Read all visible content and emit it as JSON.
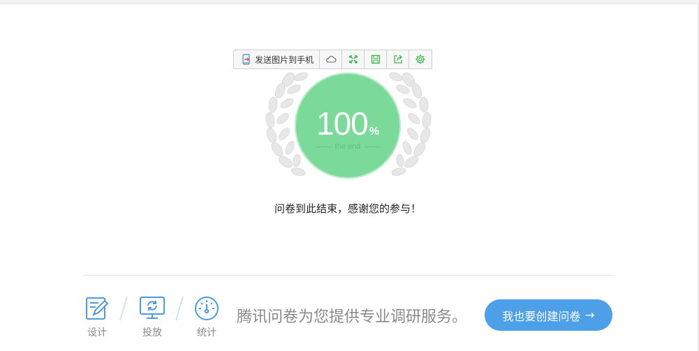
{
  "toolbar": {
    "send_label": "发送图片到手机",
    "buttons": [
      "cloud-icon",
      "fullscreen-icon",
      "save-icon",
      "share-icon",
      "settings-icon"
    ]
  },
  "badge": {
    "percent_value": "100",
    "percent_sign": "%",
    "subtitle": "the end"
  },
  "message": "问卷到此结束，感谢您的参与！",
  "footer": {
    "steps": [
      "设计",
      "投放",
      "统计"
    ],
    "promo": "腾讯问卷为您提供专业调研服务。",
    "cta_label": "我也要创建问卷",
    "cta_arrow": "→"
  },
  "colors": {
    "accent_green": "#7bd99a",
    "cta_blue": "#4d9fe8",
    "icon_blue": "#4a9be3",
    "toolbar_icon_green": "#3db84f"
  }
}
